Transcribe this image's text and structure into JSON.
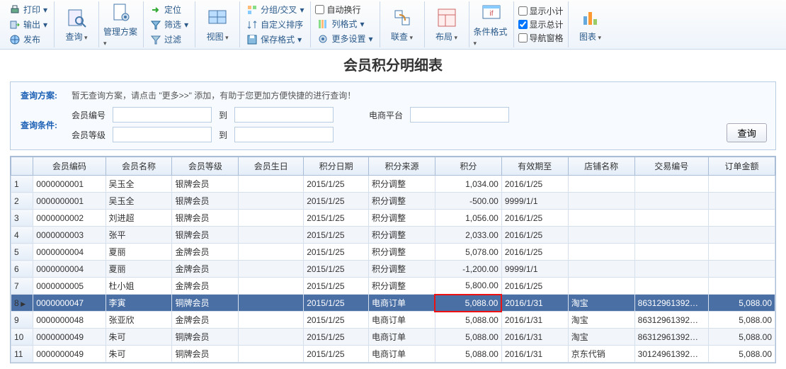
{
  "ribbon": {
    "g1": {
      "print": "打印",
      "export": "输出",
      "publish": "发布"
    },
    "g2": {
      "query": "查询"
    },
    "g3": {
      "scheme": "管理方案"
    },
    "g4": {
      "locate": "定位",
      "filter": "筛选",
      "filter2": "过滤"
    },
    "g5": {
      "view": "视图"
    },
    "g6": {
      "group": "分组/交叉",
      "sort": "自定义排序",
      "savefmt": "保存格式"
    },
    "g7": {
      "autowrap": "自动换行",
      "colfmt": "列格式",
      "more": "更多设置"
    },
    "g8": {
      "link": "联查"
    },
    "g9": {
      "layout": "布局"
    },
    "g10": {
      "condfmt": "条件格式"
    },
    "g11": {
      "subtotal": "显示小计",
      "total": "显示总计",
      "nav": "导航窗格"
    },
    "g12": {
      "chart": "图表"
    }
  },
  "title": "会员积分明细表",
  "query": {
    "plan_label": "查询方案:",
    "plan_msg": "暂无查询方案，请点击 \"更多>>\" 添加，有助于您更加方便快捷的进行查询！",
    "cond_label": "查询条件:",
    "f_memberno": "会员编号",
    "f_to1": "到",
    "f_platform": "电商平台",
    "f_level": "会员等级",
    "f_to2": "到",
    "btn": "查询"
  },
  "grid": {
    "headers": [
      "",
      "会员编码",
      "会员名称",
      "会员等级",
      "会员生日",
      "积分日期",
      "积分来源",
      "积分",
      "有效期至",
      "店铺名称",
      "交易编号",
      "订单金额"
    ],
    "rows": [
      {
        "n": "1",
        "code": "0000000001",
        "name": "吴玉全",
        "lvl": "银牌会员",
        "bday": "",
        "date": "2015/1/25",
        "src": "积分调整",
        "pts": "1,034.00",
        "exp": "2016/1/25",
        "shop": "",
        "txn": "",
        "amt": ""
      },
      {
        "n": "2",
        "code": "0000000001",
        "name": "吴玉全",
        "lvl": "银牌会员",
        "bday": "",
        "date": "2015/1/25",
        "src": "积分调整",
        "pts": "-500.00",
        "exp": "9999/1/1",
        "shop": "",
        "txn": "",
        "amt": ""
      },
      {
        "n": "3",
        "code": "0000000002",
        "name": "刘进超",
        "lvl": "银牌会员",
        "bday": "",
        "date": "2015/1/25",
        "src": "积分调整",
        "pts": "1,056.00",
        "exp": "2016/1/25",
        "shop": "",
        "txn": "",
        "amt": ""
      },
      {
        "n": "4",
        "code": "0000000003",
        "name": "张平",
        "lvl": "银牌会员",
        "bday": "",
        "date": "2015/1/25",
        "src": "积分调整",
        "pts": "2,033.00",
        "exp": "2016/1/25",
        "shop": "",
        "txn": "",
        "amt": ""
      },
      {
        "n": "5",
        "code": "0000000004",
        "name": "夏丽",
        "lvl": "金牌会员",
        "bday": "",
        "date": "2015/1/25",
        "src": "积分调整",
        "pts": "5,078.00",
        "exp": "2016/1/25",
        "shop": "",
        "txn": "",
        "amt": ""
      },
      {
        "n": "6",
        "code": "0000000004",
        "name": "夏丽",
        "lvl": "金牌会员",
        "bday": "",
        "date": "2015/1/25",
        "src": "积分调整",
        "pts": "-1,200.00",
        "exp": "9999/1/1",
        "shop": "",
        "txn": "",
        "amt": ""
      },
      {
        "n": "7",
        "code": "0000000005",
        "name": "杜小姐",
        "lvl": "金牌会员",
        "bday": "",
        "date": "2015/1/25",
        "src": "积分调整",
        "pts": "5,800.00",
        "exp": "2016/1/25",
        "shop": "",
        "txn": "",
        "amt": ""
      },
      {
        "n": "8",
        "code": "0000000047",
        "name": "李寅",
        "lvl": "铜牌会员",
        "bday": "",
        "date": "2015/1/25",
        "src": "电商订单",
        "pts": "5,088.00",
        "exp": "2016/1/31",
        "shop": "淘宝",
        "txn": "86312961392…",
        "amt": "5,088.00",
        "sel": true,
        "hl": true
      },
      {
        "n": "9",
        "code": "0000000048",
        "name": "张亚欣",
        "lvl": "金牌会员",
        "bday": "",
        "date": "2015/1/25",
        "src": "电商订单",
        "pts": "5,088.00",
        "exp": "2016/1/31",
        "shop": "淘宝",
        "txn": "86312961392…",
        "amt": "5,088.00"
      },
      {
        "n": "10",
        "code": "0000000049",
        "name": "朱可",
        "lvl": "铜牌会员",
        "bday": "",
        "date": "2015/1/25",
        "src": "电商订单",
        "pts": "5,088.00",
        "exp": "2016/1/31",
        "shop": "淘宝",
        "txn": "86312961392…",
        "amt": "5,088.00"
      },
      {
        "n": "11",
        "code": "0000000049",
        "name": "朱可",
        "lvl": "铜牌会员",
        "bday": "",
        "date": "2015/1/25",
        "src": "电商订单",
        "pts": "5,088.00",
        "exp": "2016/1/31",
        "shop": "京东代销",
        "txn": "30124961392…",
        "amt": "5,088.00"
      }
    ]
  }
}
